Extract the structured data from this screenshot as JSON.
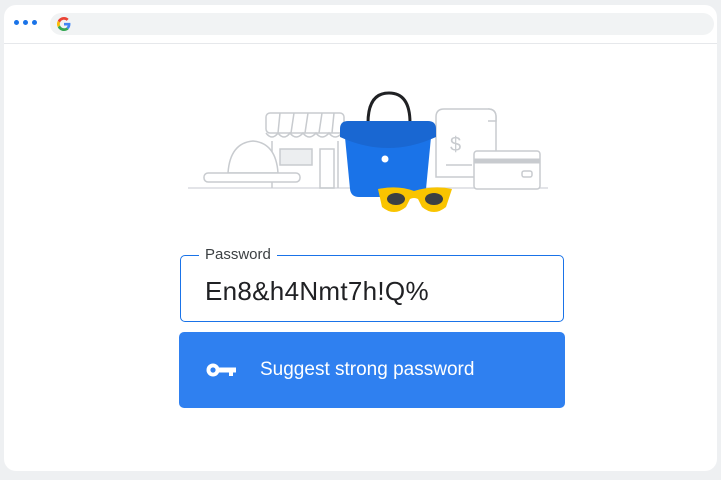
{
  "browser": {
    "menu_icon": "three-dots-icon",
    "favicon": "google-g-icon",
    "address_text": ""
  },
  "illustration": {
    "items": [
      "store-icon",
      "hat-icon",
      "handbag-icon",
      "sunglasses-icon",
      "receipt-icon",
      "credit-card-icon"
    ],
    "receipt_symbol": "$"
  },
  "password_field": {
    "label": "Password",
    "value": "En8&h4Nmt7h!Q%"
  },
  "suggest_button": {
    "icon": "key-icon",
    "label": "Suggest strong password"
  },
  "colors": {
    "accent": "#1a73e8",
    "button": "#2f80f0",
    "handbag": "#1a73e8",
    "sunglasses": "#f9c400"
  }
}
